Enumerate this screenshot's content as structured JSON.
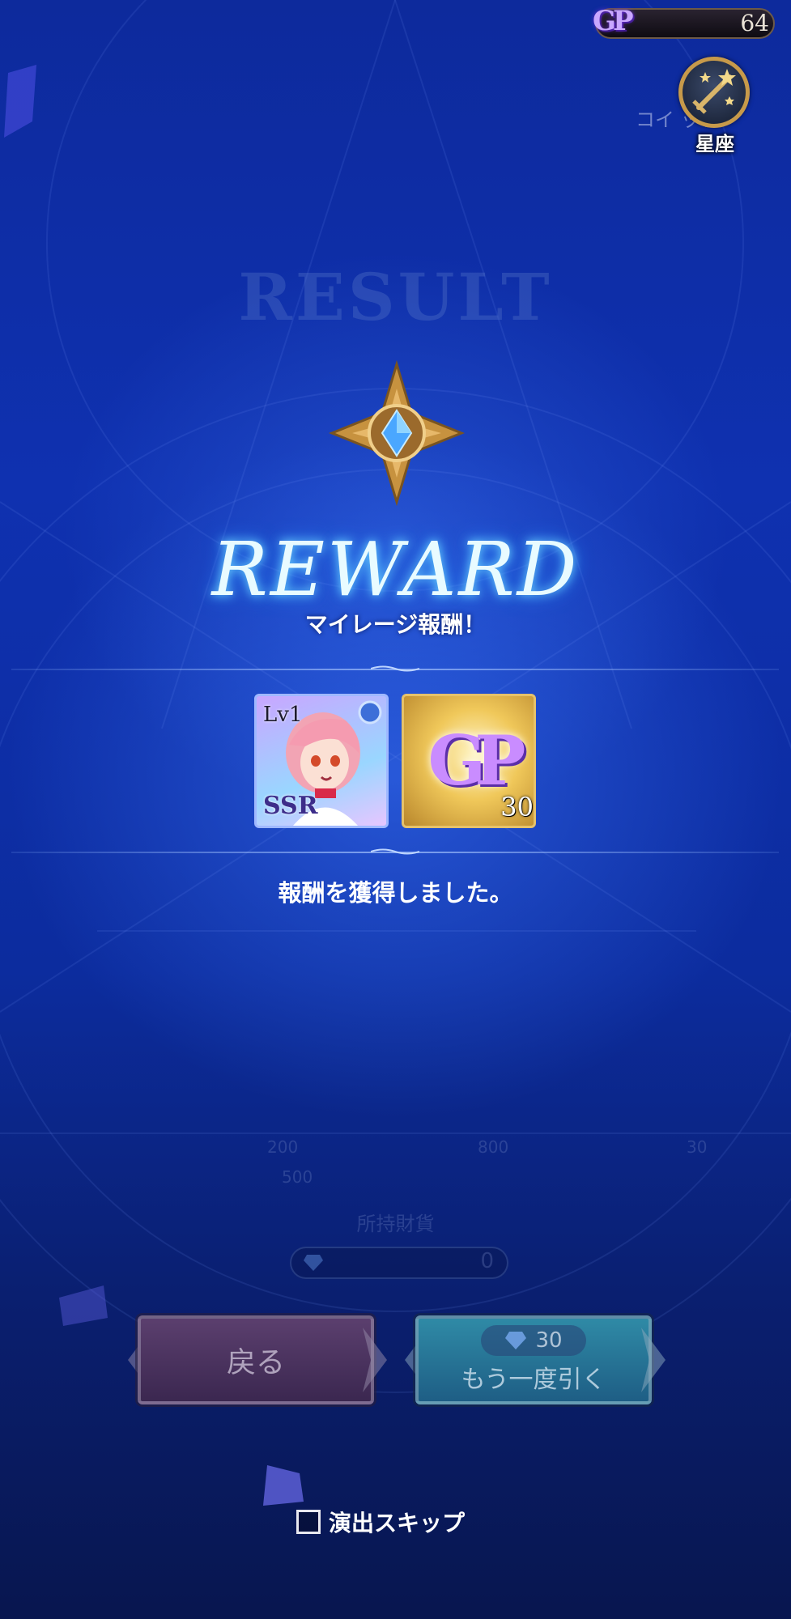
{
  "header": {
    "gp_icon_text": "GP",
    "gp_value": "64",
    "coin_shop_label": "コイ  ップ",
    "seiza_label": "星座"
  },
  "result": {
    "title": "RESULT"
  },
  "reward": {
    "title": "REWARD",
    "subtitle": "マイレージ報酬！",
    "items": [
      {
        "type": "character-card",
        "level_label": "Lv1",
        "rarity_label": "SSR"
      },
      {
        "type": "gp-item",
        "icon_text": "GP",
        "quantity": "30"
      }
    ],
    "acquired_message": "報酬を獲得しました。"
  },
  "background_ui": {
    "milestones": [
      "200",
      "800",
      "30",
      "500"
    ],
    "owned_label": "所持財貨",
    "owned_value": "0"
  },
  "buttons": {
    "back_label": "戻る",
    "again_cost": "30",
    "again_label": "もう一度引く"
  },
  "skip": {
    "label": "演出スキップ",
    "checked": false
  },
  "colors": {
    "background": "#0f31b0",
    "reward_glow": "#6fd8ff",
    "gold": "#c79a4a"
  }
}
